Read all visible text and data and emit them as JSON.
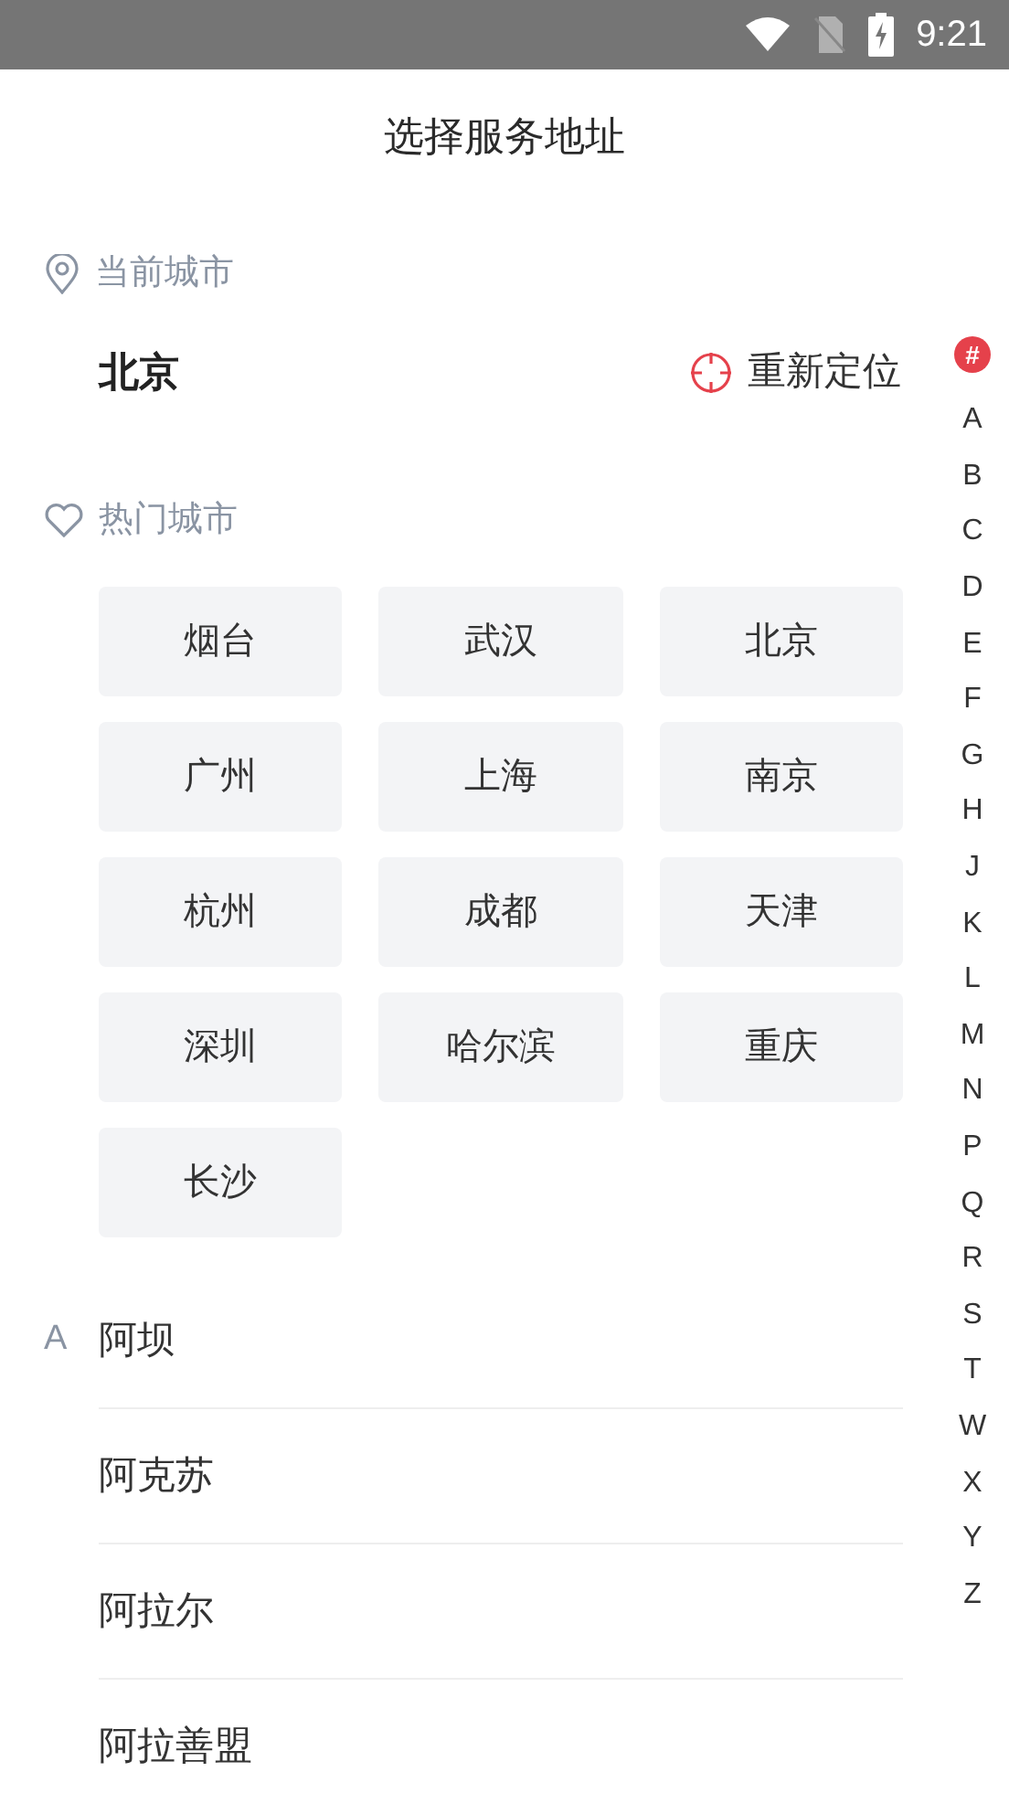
{
  "status_bar": {
    "time": "9:21"
  },
  "header": {
    "title": "选择服务地址"
  },
  "current_city": {
    "label": "当前城市",
    "city": "北京",
    "relocate": "重新定位"
  },
  "hot_cities": {
    "label": "热门城市",
    "items": [
      "烟台",
      "武汉",
      "北京",
      "广州",
      "上海",
      "南京",
      "杭州",
      "成都",
      "天津",
      "深圳",
      "哈尔滨",
      "重庆",
      "长沙"
    ]
  },
  "city_list": [
    {
      "letter": "A",
      "items": [
        "阿坝",
        "阿克苏",
        "阿拉尔",
        "阿拉善盟"
      ]
    }
  ],
  "index_bar": [
    {
      "label": "#",
      "selected": true
    },
    {
      "label": "A",
      "selected": false
    },
    {
      "label": "B",
      "selected": false
    },
    {
      "label": "C",
      "selected": false
    },
    {
      "label": "D",
      "selected": false
    },
    {
      "label": "E",
      "selected": false
    },
    {
      "label": "F",
      "selected": false
    },
    {
      "label": "G",
      "selected": false
    },
    {
      "label": "H",
      "selected": false
    },
    {
      "label": "J",
      "selected": false
    },
    {
      "label": "K",
      "selected": false
    },
    {
      "label": "L",
      "selected": false
    },
    {
      "label": "M",
      "selected": false
    },
    {
      "label": "N",
      "selected": false
    },
    {
      "label": "P",
      "selected": false
    },
    {
      "label": "Q",
      "selected": false
    },
    {
      "label": "R",
      "selected": false
    },
    {
      "label": "S",
      "selected": false
    },
    {
      "label": "T",
      "selected": false
    },
    {
      "label": "W",
      "selected": false
    },
    {
      "label": "X",
      "selected": false
    },
    {
      "label": "Y",
      "selected": false
    },
    {
      "label": "Z",
      "selected": false
    }
  ]
}
